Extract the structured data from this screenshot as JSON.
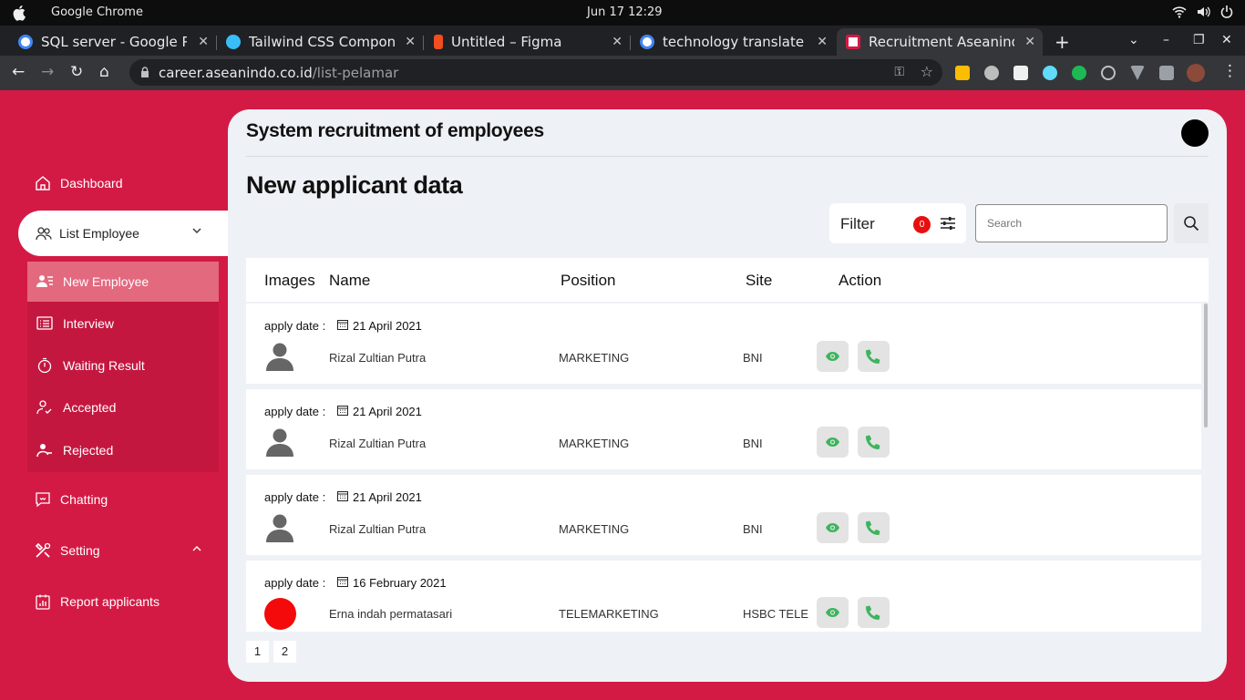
{
  "os": {
    "app_name": "Google Chrome",
    "clock": "Jun 17  12:29"
  },
  "browser": {
    "tabs": [
      {
        "label": "SQL server - Google Pe",
        "favicon_color": "#4285f4"
      },
      {
        "label": "Tailwind CSS Compone",
        "favicon_color": "#38bdf8"
      },
      {
        "label": "Untitled – Figma",
        "favicon_color": "#f24e1e"
      },
      {
        "label": "technology translate -",
        "favicon_color": "#4285f4"
      },
      {
        "label": "Recruitment Aseanindo",
        "favicon_color": "#d31a45"
      }
    ],
    "url_host": "career.aseanindo.co.id",
    "url_path": "/list-pelamar"
  },
  "sidebar": {
    "dashboard": "Dashboard",
    "list_employee": "List Employee",
    "submenu": [
      {
        "label": "New Employee"
      },
      {
        "label": "Interview"
      },
      {
        "label": "Waiting Result"
      },
      {
        "label": "Accepted"
      },
      {
        "label": "Rejected"
      }
    ],
    "chatting": "Chatting",
    "setting": "Setting",
    "report": "Report applicants"
  },
  "main": {
    "system_title": "System recruitment of employees",
    "page_title": "New applicant data",
    "filter_label": "Filter",
    "filter_count": "0",
    "search_placeholder": "Search",
    "columns": {
      "images": "Images",
      "name": "Name",
      "position": "Position",
      "site": "Site",
      "action": "Action"
    },
    "apply_date_label": "apply date :",
    "rows": [
      {
        "date": "21 April 2021",
        "name": "Rizal Zultian Putra",
        "position": "MARKETING",
        "site": "BNI",
        "image": "default-avatar"
      },
      {
        "date": "21 April 2021",
        "name": "Rizal Zultian Putra",
        "position": "MARKETING",
        "site": "BNI",
        "image": "default-avatar"
      },
      {
        "date": "21 April 2021",
        "name": "Rizal Zultian Putra",
        "position": "MARKETING",
        "site": "BNI",
        "image": "default-avatar"
      },
      {
        "date": "16 February 2021",
        "name": "Erna indah permatasari",
        "position": "TELEMARKETING",
        "site": "HSBC TELE",
        "image": "red-photo"
      }
    ],
    "pages": [
      "1",
      "2"
    ]
  },
  "colors": {
    "brand": "#d31a45",
    "submenu_bg": "#c41740",
    "submenu_active": "#e3697f",
    "action_icon": "#3cb55d",
    "filter_badge": "#e80f0f"
  }
}
